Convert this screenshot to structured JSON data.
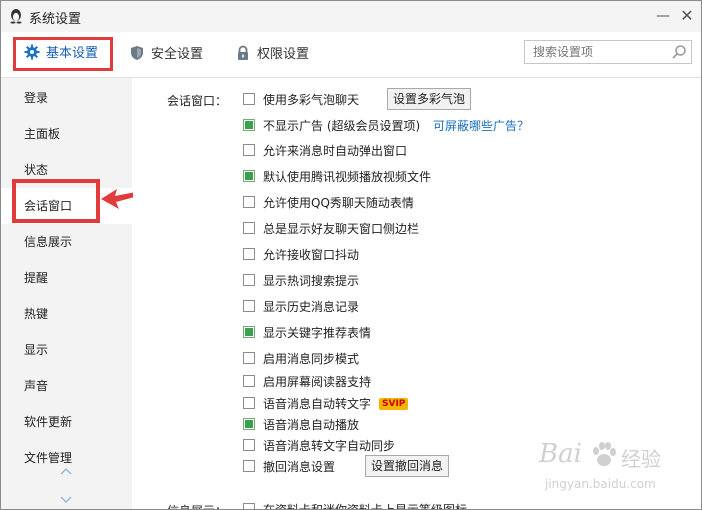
{
  "window": {
    "title": "系统设置",
    "minimize_glyph": "—",
    "close_glyph": "✕"
  },
  "topbar": {
    "tabs": [
      {
        "label": "基本设置",
        "icon": "gear-icon"
      },
      {
        "label": "安全设置",
        "icon": "shield-icon"
      },
      {
        "label": "权限设置",
        "icon": "lock-icon"
      }
    ],
    "search": {
      "placeholder": "搜索设置项",
      "value": ""
    }
  },
  "sidebar": {
    "items": [
      {
        "label": "登录"
      },
      {
        "label": "主面板"
      },
      {
        "label": "状态"
      },
      {
        "label": "会话窗口"
      },
      {
        "label": "信息展示"
      },
      {
        "label": "提醒"
      },
      {
        "label": "热键"
      },
      {
        "label": "显示"
      },
      {
        "label": "声音"
      },
      {
        "label": "软件更新"
      },
      {
        "label": "文件管理"
      }
    ],
    "active_index": 3
  },
  "content": {
    "section_label": "会话窗口：",
    "options": [
      {
        "label": "使用多彩气泡聊天",
        "checked": false,
        "button": "设置多彩气泡"
      },
      {
        "label": "不显示广告 (超级会员设置项)",
        "checked": true,
        "link": "可屏蔽哪些广告？"
      },
      {
        "label": "允许来消息时自动弹出窗口",
        "checked": false
      },
      {
        "label": "默认使用腾讯视频播放视频文件",
        "checked": true
      },
      {
        "label": "允许使用QQ秀聊天随动表情",
        "checked": false
      },
      {
        "label": "总是显示好友聊天窗口侧边栏",
        "checked": false
      },
      {
        "label": "允许接收窗口抖动",
        "checked": false
      },
      {
        "label": "显示热词搜索提示",
        "checked": false
      },
      {
        "label": "显示历史消息记录",
        "checked": false
      },
      {
        "label": "显示关键字推荐表情",
        "checked": true
      },
      {
        "label": "启用消息同步模式",
        "checked": false
      },
      {
        "label": "启用屏幕阅读器支持",
        "checked": false
      },
      {
        "label": "语音消息自动转文字",
        "checked": false,
        "badge": "SVIP"
      },
      {
        "label": "语音消息自动播放",
        "checked": true
      },
      {
        "label": "语音消息转文字自动同步",
        "checked": false
      },
      {
        "label": "撤回消息设置",
        "checked": false,
        "button": "设置撤回消息"
      }
    ],
    "next_section_label": "信息展示：",
    "next_section_option": "在资料卡和迷你资料卡上显示等级图标"
  },
  "watermark": {
    "brand": "Bai",
    "brand2": "经验",
    "url": "jingyan.baidu.com"
  },
  "colors": {
    "highlight": "#e23b3b",
    "link": "#1a6fb8",
    "check": "#3aa14d",
    "sidebar_bg": "#f3f3f3"
  }
}
